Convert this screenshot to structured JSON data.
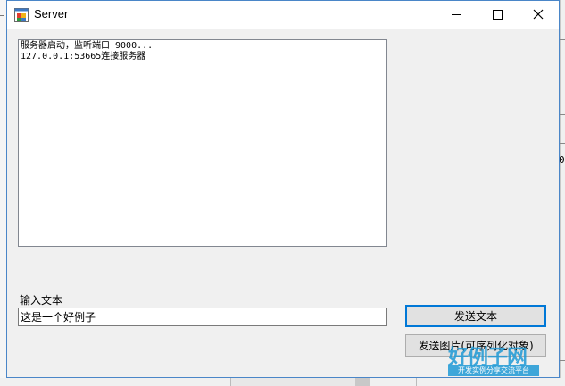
{
  "window": {
    "title": "Server",
    "icon": "windows-forms-app-icon",
    "controls": [
      "minimize-icon",
      "maximize-icon",
      "close-icon"
    ]
  },
  "log": {
    "lines": [
      "服务器启动，监听端口 9000...",
      "127.0.0.1:53665连接服务器"
    ]
  },
  "input": {
    "label": "输入文本",
    "value": "这是一个好例子"
  },
  "buttons": {
    "send_text": "发送文本",
    "send_image": "发送图片(可序列化对象)"
  },
  "background": {
    "right_digit": "0"
  },
  "watermark": {
    "main": "好例子网",
    "sub": "开发实例分享交流平台",
    "color": "#1f9ad6"
  }
}
